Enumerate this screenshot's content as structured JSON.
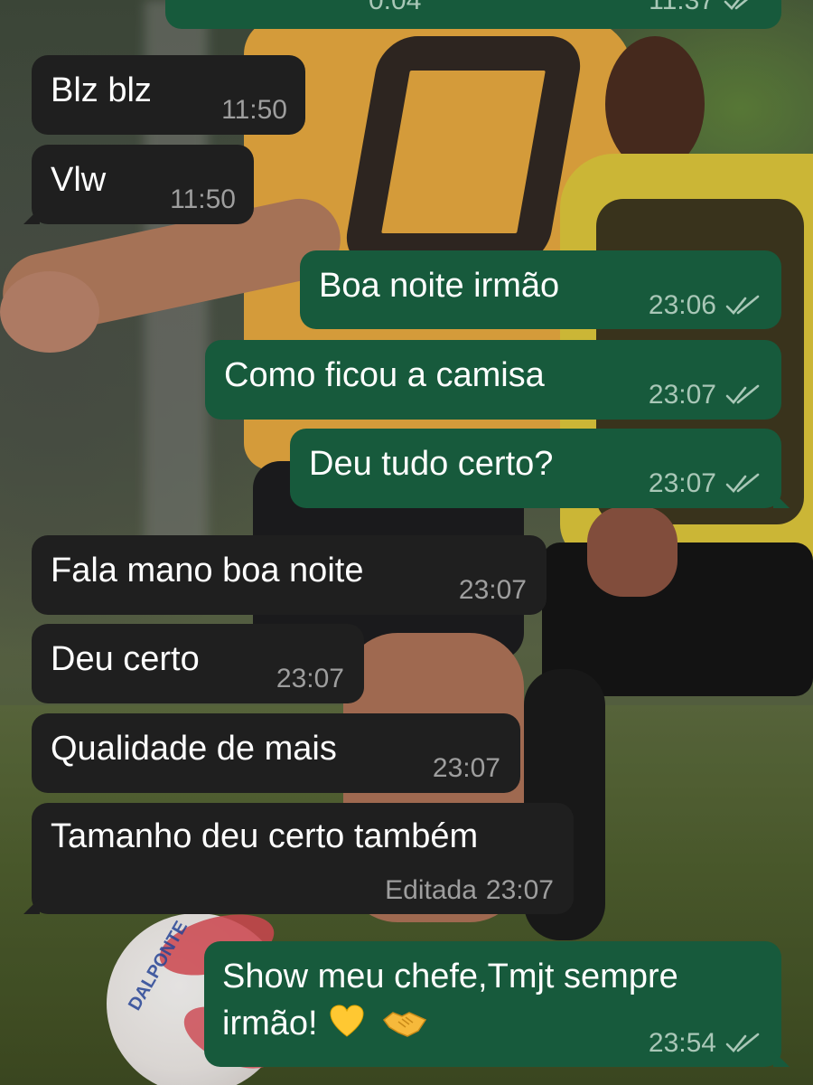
{
  "colors": {
    "incoming_bubble": "#1f1f1f",
    "outgoing_bubble": "#175a3c",
    "incoming_time": "#9e9e9e",
    "outgoing_time": "#a9c7b7",
    "read_ticks": "#a9c7b7"
  },
  "wallpaper": {
    "ball_brand_text": "DALPONTE"
  },
  "messages": [
    {
      "direction": "out",
      "text": "",
      "duration": "0:04",
      "time": "11:37",
      "status": "read",
      "type": "voice",
      "partial": true
    },
    {
      "direction": "in",
      "text": "Blz blz",
      "time": "11:50"
    },
    {
      "direction": "in",
      "text": "Vlw",
      "time": "11:50"
    },
    {
      "direction": "out",
      "text": "Boa noite irmão",
      "time": "23:06",
      "status": "read"
    },
    {
      "direction": "out",
      "text": "Como ficou a camisa",
      "time": "23:07",
      "status": "read"
    },
    {
      "direction": "out",
      "text": "Deu tudo certo?",
      "time": "23:07",
      "status": "read"
    },
    {
      "direction": "in",
      "text": "Fala mano boa noite",
      "time": "23:07"
    },
    {
      "direction": "in",
      "text": "Deu certo",
      "time": "23:07"
    },
    {
      "direction": "in",
      "text": "Qualidade de mais",
      "time": "23:07"
    },
    {
      "direction": "in",
      "text": "Tamanho deu certo também",
      "time": "23:07",
      "edited_label": "Editada"
    },
    {
      "direction": "out",
      "text_line1": "Show meu chefe,Tmjt sempre",
      "text_line2": "irmão!",
      "emojis": [
        "yellow-heart",
        "handshake"
      ],
      "time": "23:54",
      "status": "read"
    }
  ]
}
